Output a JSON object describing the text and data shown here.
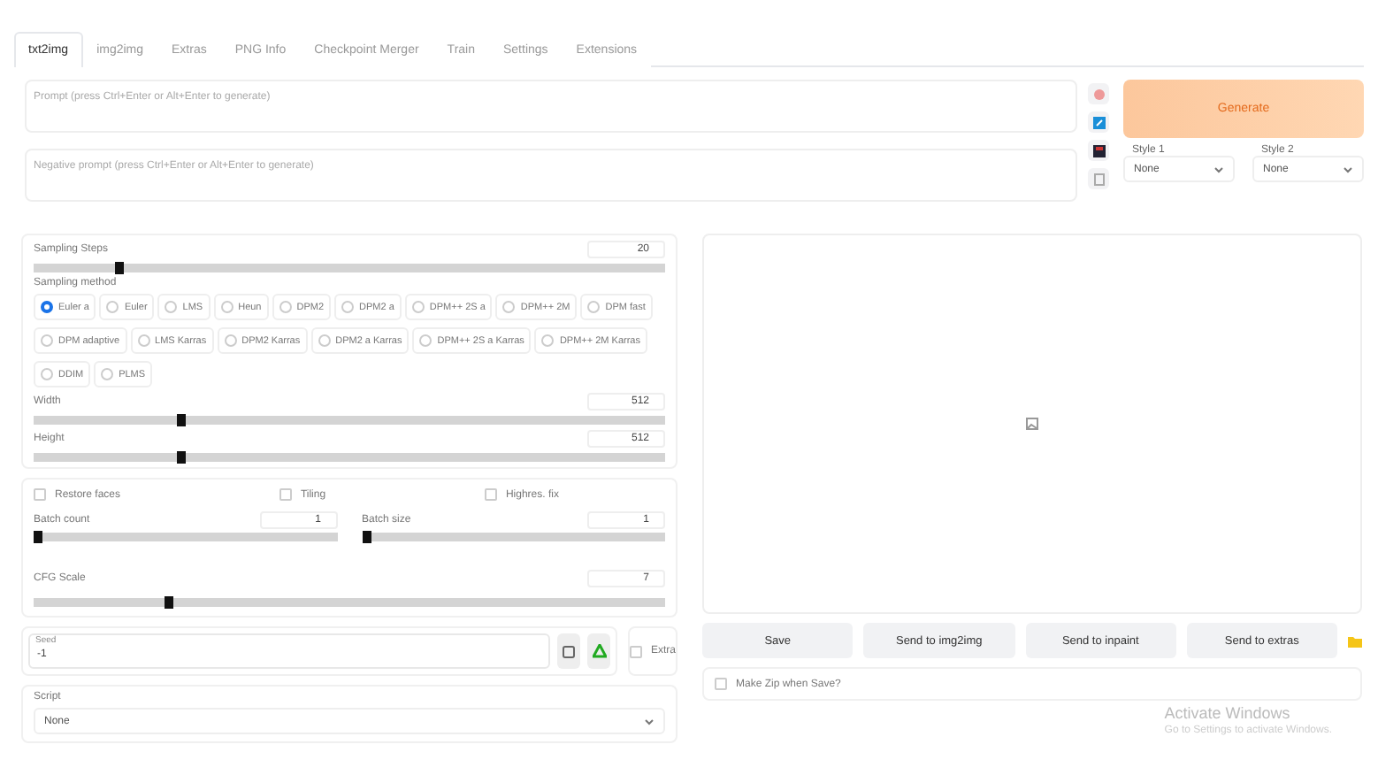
{
  "tabs": [
    {
      "label": "txt2img",
      "selected": true
    },
    {
      "label": "img2img",
      "selected": false
    },
    {
      "label": "Extras",
      "selected": false
    },
    {
      "label": "PNG Info",
      "selected": false
    },
    {
      "label": "Checkpoint Merger",
      "selected": false
    },
    {
      "label": "Train",
      "selected": false
    },
    {
      "label": "Settings",
      "selected": false
    },
    {
      "label": "Extensions",
      "selected": false
    }
  ],
  "prompt": {
    "placeholder": "Prompt (press Ctrl+Enter or Alt+Enter to generate)"
  },
  "negative_prompt": {
    "placeholder": "Negative prompt (press Ctrl+Enter or Alt+Enter to generate)"
  },
  "generate_button": "Generate",
  "styles": [
    {
      "label": "Style 1",
      "value": "None"
    },
    {
      "label": "Style 2",
      "value": "None"
    }
  ],
  "sampling_steps": {
    "label": "Sampling Steps",
    "value": "20",
    "level": 0.13
  },
  "sampling_method": {
    "label": "Sampling method",
    "options": [
      {
        "label": "Euler a",
        "selected": true
      },
      {
        "label": "Euler",
        "selected": false
      },
      {
        "label": "LMS",
        "selected": false
      },
      {
        "label": "Heun",
        "selected": false
      },
      {
        "label": "DPM2",
        "selected": false
      },
      {
        "label": "DPM2 a",
        "selected": false
      },
      {
        "label": "DPM++ 2S a",
        "selected": false
      },
      {
        "label": "DPM++ 2M",
        "selected": false
      },
      {
        "label": "DPM fast",
        "selected": false
      },
      {
        "label": "DPM adaptive",
        "selected": false
      },
      {
        "label": "LMS Karras",
        "selected": false
      },
      {
        "label": "DPM2 Karras",
        "selected": false
      },
      {
        "label": "DPM2 a Karras",
        "selected": false
      },
      {
        "label": "DPM++ 2S a Karras",
        "selected": false
      },
      {
        "label": "DPM++ 2M Karras",
        "selected": false
      },
      {
        "label": "DDIM",
        "selected": false
      },
      {
        "label": "PLMS",
        "selected": false
      }
    ]
  },
  "size": [
    {
      "label": "Width",
      "value": "512",
      "level": 0.23
    },
    {
      "label": "Height",
      "value": "512",
      "level": 0.23
    }
  ],
  "options": [
    {
      "label": "Restore faces",
      "checked": false
    },
    {
      "label": "Tiling",
      "checked": false
    },
    {
      "label": "Highres. fix",
      "checked": false
    }
  ],
  "batch": [
    {
      "label": "Batch count",
      "value": "1",
      "level": 0
    },
    {
      "label": "Batch size",
      "value": "1",
      "level": 0
    }
  ],
  "cfg_scale": {
    "label": "CFG Scale",
    "value": "7",
    "level": 0.21
  },
  "seed": {
    "label": "Seed",
    "value": "-1",
    "extra": {
      "label": "Extra",
      "checked": false
    }
  },
  "script": {
    "label": "Script",
    "value": "None"
  },
  "output_buttons": [
    "Save",
    "Send to img2img",
    "Send to inpaint",
    "Send to extras"
  ],
  "make_zip": {
    "label": "Make Zip when Save?",
    "checked": false
  },
  "activation_notice": {
    "title": "Activate Windows",
    "text": "Go to Settings to activate Windows."
  }
}
